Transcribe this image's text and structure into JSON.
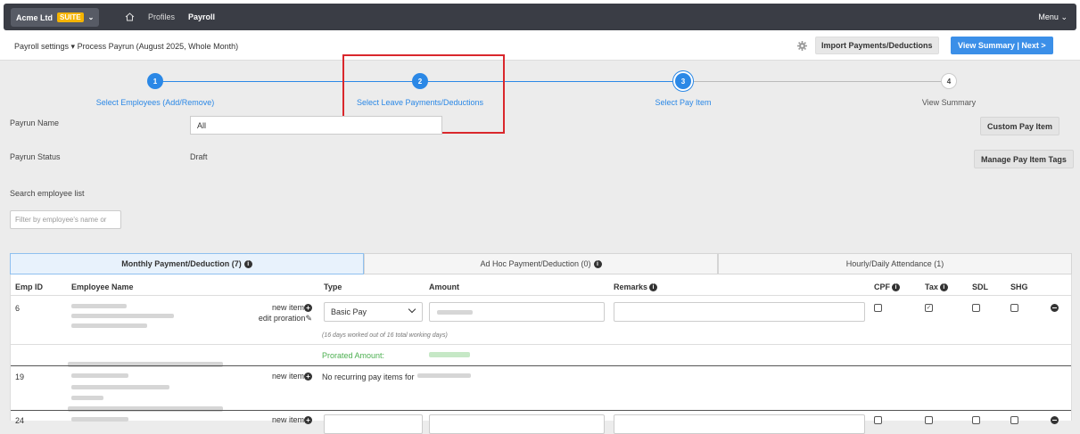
{
  "topbar": {
    "company": "Acme Ltd",
    "suite_badge": "SUITE",
    "nav": [
      {
        "label": "Profiles"
      },
      {
        "label": "Payroll"
      }
    ],
    "menu_label": "Menu"
  },
  "subheader": {
    "breadcrumb_settings": "Payroll settings",
    "breadcrumb_current": "Process Payrun (August 2025, Whole Month)",
    "import_button": "Import Payments/Deductions",
    "next_button": "View Summary | Next >"
  },
  "stepper": {
    "steps": [
      {
        "number": "1",
        "label": "Select Employees (Add/Remove)",
        "state": "done"
      },
      {
        "number": "2",
        "label": "Select Leave Payments/Deductions",
        "state": "done"
      },
      {
        "number": "3",
        "label": "Select Pay Item",
        "state": "current"
      },
      {
        "number": "4",
        "label": "View Summary",
        "state": "todo"
      }
    ]
  },
  "form": {
    "payrun_name_label": "Payrun Name",
    "payrun_name_value": "All",
    "payrun_status_label": "Payrun Status",
    "payrun_status_value": "Draft",
    "custom_pay_item_button": "Custom Pay Item",
    "manage_tags_button": "Manage Pay Item Tags",
    "search_label": "Search employee list",
    "filter_placeholder": "Filter by employee's name or"
  },
  "tabs": [
    {
      "label": "Monthly Payment/Deduction (7)",
      "active": true
    },
    {
      "label": "Ad Hoc Payment/Deduction (0)",
      "active": false
    },
    {
      "label": "Hourly/Daily Attendance (1)",
      "active": false
    }
  ],
  "table": {
    "headers": {
      "emp_id": "Emp ID",
      "employee_name": "Employee Name",
      "type": "Type",
      "amount": "Amount",
      "remarks": "Remarks",
      "cpf": "CPF",
      "tax": "Tax",
      "sdl": "SDL",
      "shg": "SHG"
    },
    "rows": [
      {
        "emp_id": "6",
        "new_item": "new item",
        "edit_proration": "edit proration",
        "type": "Basic Pay",
        "note": "(16 days worked out of 16 total working days)",
        "prorated_label": "Prorated Amount:"
      },
      {
        "emp_id": "19",
        "new_item": "new item",
        "no_items": "No recurring pay items for"
      },
      {
        "emp_id": "24",
        "new_item": "new item"
      }
    ]
  },
  "colors": {
    "topbar": "#3a3d45",
    "accent": "#2b88e6",
    "highlight": "#d9272c",
    "suite": "#f5b400"
  }
}
